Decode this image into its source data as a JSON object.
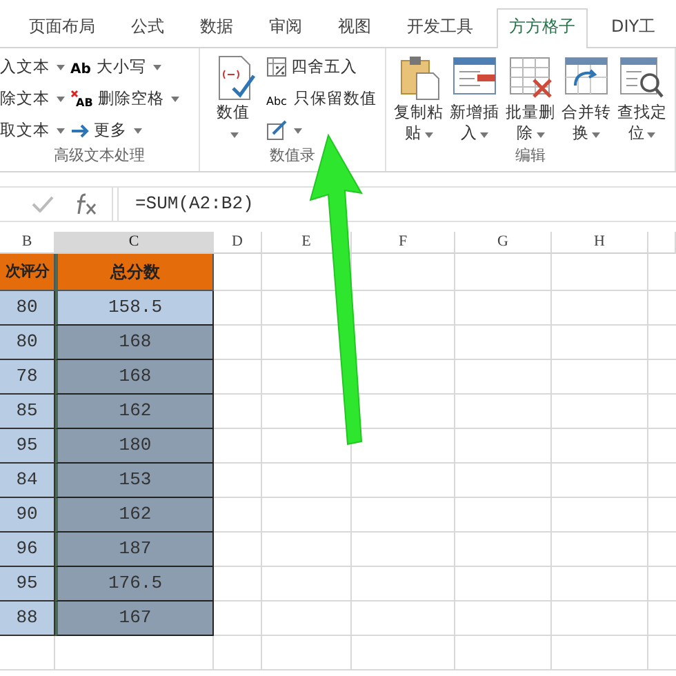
{
  "tabs": [
    {
      "label": "页面布局",
      "selected": false
    },
    {
      "label": "公式",
      "selected": false
    },
    {
      "label": "数据",
      "selected": false
    },
    {
      "label": "审阅",
      "selected": false
    },
    {
      "label": "视图",
      "selected": false
    },
    {
      "label": "开发工具",
      "selected": false
    },
    {
      "label": "方方格子",
      "selected": true
    },
    {
      "label": "DIY工",
      "selected": false
    }
  ],
  "ribbon_groups": [
    {
      "label": "高级文本处理",
      "items": [
        {
          "kind": "text",
          "label": "入文本",
          "dropdown": true
        },
        {
          "kind": "text",
          "label": "除文本",
          "dropdown": true
        },
        {
          "kind": "text",
          "label": "取文本",
          "dropdown": true
        },
        {
          "kind": "small",
          "label": "大小写",
          "icon_text": "Ab",
          "dropdown": true
        },
        {
          "kind": "small",
          "label": "删除空格",
          "icon_text": "AB",
          "dropdown": true
        },
        {
          "kind": "small",
          "label": "更多",
          "dropdown": true
        }
      ]
    },
    {
      "label": "数值录",
      "items": [
        {
          "kind": "large",
          "label": "数值",
          "dropdown": true
        },
        {
          "kind": "small",
          "label": "四舍五入",
          "dropdown": false
        },
        {
          "kind": "small",
          "label": "只保留数值",
          "icon_text": "Abc",
          "dropdown": false
        },
        {
          "kind": "small",
          "dropdown": true
        }
      ]
    },
    {
      "label": "编辑",
      "items": [
        {
          "kind": "large",
          "label": "复制粘",
          "label2": "贴",
          "dropdown": true
        },
        {
          "kind": "large",
          "label": "新增插",
          "label2": "入",
          "dropdown": true
        },
        {
          "kind": "large",
          "label": "批量删",
          "label2": "除",
          "dropdown": true
        },
        {
          "kind": "large",
          "label": "合并转",
          "label2": "换",
          "dropdown": true
        },
        {
          "kind": "large",
          "label": "查找定",
          "label2": "位",
          "dropdown": true
        }
      ]
    }
  ],
  "formula_bar": {
    "formula": "=SUM(A2:B2)"
  },
  "columns": [
    {
      "label": "B",
      "selected": false
    },
    {
      "label": "C",
      "selected": true
    },
    {
      "label": "D",
      "selected": false
    },
    {
      "label": "E",
      "selected": false
    },
    {
      "label": "F",
      "selected": false
    },
    {
      "label": "G",
      "selected": false
    },
    {
      "label": "H",
      "selected": false
    }
  ],
  "table": {
    "headers": [
      "次评分",
      "总分数"
    ],
    "rows": [
      {
        "b": "80",
        "c": "158.5",
        "active": true
      },
      {
        "b": "80",
        "c": "168",
        "active": false
      },
      {
        "b": "78",
        "c": "168",
        "active": false
      },
      {
        "b": "85",
        "c": "162",
        "active": false
      },
      {
        "b": "95",
        "c": "180",
        "active": false
      },
      {
        "b": "84",
        "c": "153",
        "active": false
      },
      {
        "b": "90",
        "c": "162",
        "active": false
      },
      {
        "b": "96",
        "c": "187",
        "active": false
      },
      {
        "b": "95",
        "c": "176.5",
        "active": false
      },
      {
        "b": "88",
        "c": "167",
        "active": false
      }
    ]
  }
}
